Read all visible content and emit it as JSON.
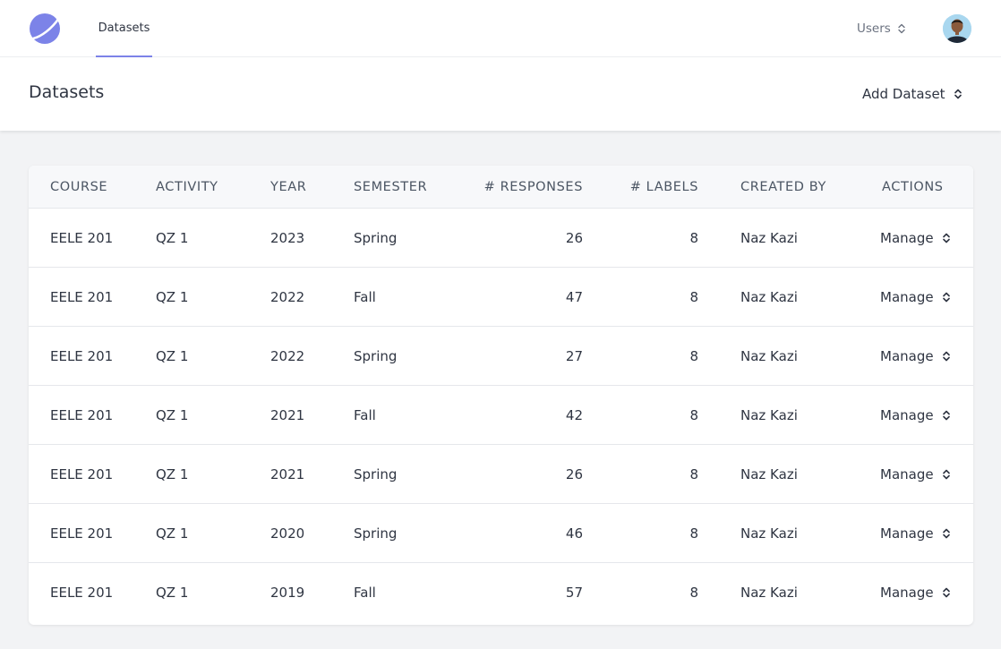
{
  "nav": {
    "logo_icon": "app-logo-icon",
    "active_tab": "Datasets",
    "users_label": "Users",
    "accent_color": "#7c83e8"
  },
  "header": {
    "title": "Datasets",
    "add_label": "Add Dataset"
  },
  "table": {
    "columns": [
      "COURSE",
      "ACTIVITY",
      "YEAR",
      "SEMESTER",
      "# RESPONSES",
      "# LABELS",
      "CREATED BY",
      "ACTIONS"
    ],
    "rows": [
      {
        "course": "EELE 201",
        "activity": "QZ 1",
        "year": "2023",
        "semester": "Spring",
        "responses": "26",
        "labels": "8",
        "created_by": "Naz Kazi",
        "action": "Manage"
      },
      {
        "course": "EELE 201",
        "activity": "QZ 1",
        "year": "2022",
        "semester": "Fall",
        "responses": "47",
        "labels": "8",
        "created_by": "Naz Kazi",
        "action": "Manage"
      },
      {
        "course": "EELE 201",
        "activity": "QZ 1",
        "year": "2022",
        "semester": "Spring",
        "responses": "27",
        "labels": "8",
        "created_by": "Naz Kazi",
        "action": "Manage"
      },
      {
        "course": "EELE 201",
        "activity": "QZ 1",
        "year": "2021",
        "semester": "Fall",
        "responses": "42",
        "labels": "8",
        "created_by": "Naz Kazi",
        "action": "Manage"
      },
      {
        "course": "EELE 201",
        "activity": "QZ 1",
        "year": "2021",
        "semester": "Spring",
        "responses": "26",
        "labels": "8",
        "created_by": "Naz Kazi",
        "action": "Manage"
      },
      {
        "course": "EELE 201",
        "activity": "QZ 1",
        "year": "2020",
        "semester": "Spring",
        "responses": "46",
        "labels": "8",
        "created_by": "Naz Kazi",
        "action": "Manage"
      },
      {
        "course": "EELE 201",
        "activity": "QZ 1",
        "year": "2019",
        "semester": "Fall",
        "responses": "57",
        "labels": "8",
        "created_by": "Naz Kazi",
        "action": "Manage"
      }
    ]
  }
}
